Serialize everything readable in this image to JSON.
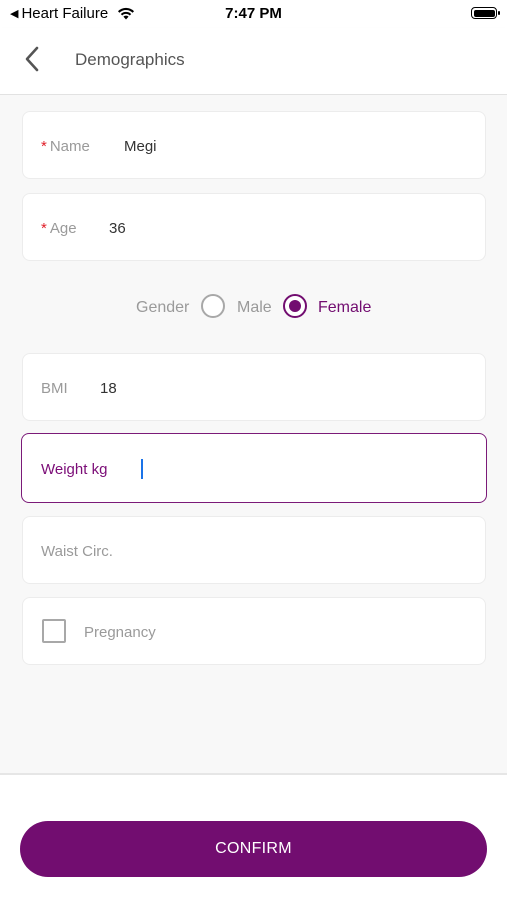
{
  "status_bar": {
    "back_app": "Heart Failure",
    "time": "7:47 PM"
  },
  "nav": {
    "title": "Demographics"
  },
  "form": {
    "name": {
      "label": "Name",
      "required_mark": "*",
      "value": "Megi"
    },
    "age": {
      "label": "Age",
      "required_mark": "*",
      "value": "36"
    },
    "gender": {
      "label": "Gender",
      "options": [
        "Male",
        "Female"
      ],
      "selected": "Female"
    },
    "bmi": {
      "label": "BMI",
      "value": "18"
    },
    "weight": {
      "label": "Weight kg",
      "value": ""
    },
    "waist": {
      "label": "Waist Circ.",
      "value": ""
    },
    "pregnancy": {
      "label": "Pregnancy",
      "checked": false
    }
  },
  "actions": {
    "confirm_label": "CONFIRM"
  },
  "colors": {
    "accent": "#720d70",
    "required": "#e0202a",
    "cursor": "#1a73e8"
  }
}
